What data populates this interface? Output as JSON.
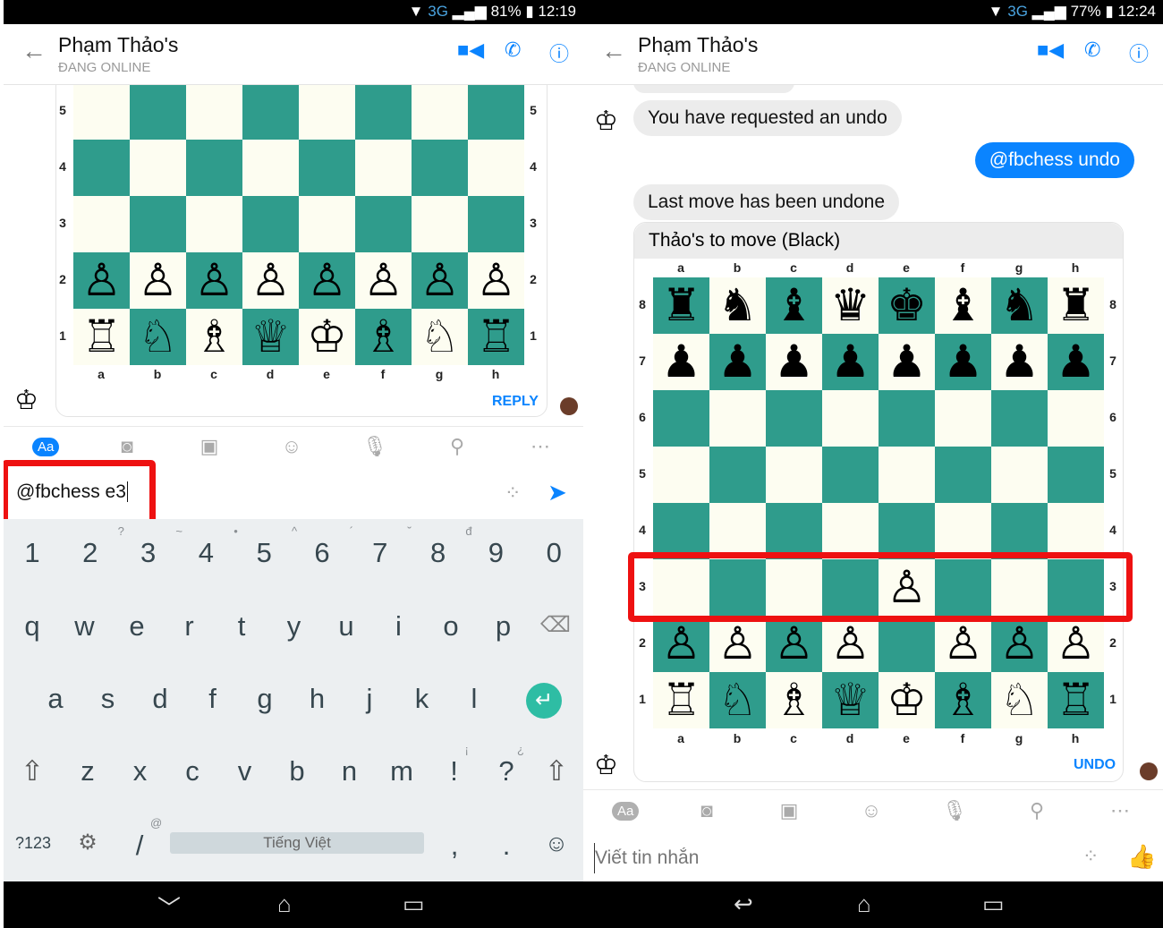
{
  "colors": {
    "accent": "#0a84ff",
    "board_dark": "#2f9c8c",
    "board_light": "#fdfdf1",
    "highlight": "#ee1111"
  },
  "left": {
    "status": {
      "network": "3G",
      "battery": "81%",
      "time": "12:19"
    },
    "header": {
      "title": "Phạm Thảo's",
      "subtitle": "ĐANG ONLINE"
    },
    "board": {
      "files": [
        "a",
        "b",
        "c",
        "d",
        "e",
        "f",
        "g",
        "h"
      ],
      "ranks": [
        "5",
        "4",
        "3",
        "2",
        "1"
      ],
      "rows": [
        "........",
        "........",
        "........",
        "PPPPPPPP",
        "RNBQKBNR"
      ]
    },
    "reply_label": "REPLY",
    "composer": {
      "mode_label": "Aa",
      "value": "@fbchess e3"
    },
    "keyboard": {
      "numbers": [
        "1",
        "2",
        "3",
        "4",
        "5",
        "6",
        "7",
        "8",
        "9",
        "0"
      ],
      "number_hints": [
        "",
        "",
        "?",
        "~",
        "•",
        "^",
        "´",
        "˘",
        "đ",
        ""
      ],
      "row1": [
        "q",
        "w",
        "e",
        "r",
        "t",
        "y",
        "u",
        "i",
        "o",
        "p"
      ],
      "row2": [
        "a",
        "s",
        "d",
        "f",
        "g",
        "h",
        "j",
        "k",
        "l"
      ],
      "row3": [
        "z",
        "x",
        "c",
        "v",
        "b",
        "n",
        "m",
        "!",
        "?"
      ],
      "row3_hints": [
        "",
        "",
        "",
        "",
        "",
        "",
        "",
        "¡",
        "¿"
      ],
      "symbols_key": "?123",
      "slash_key": "/",
      "slash_hint": "@",
      "space_label": "Tiếng Việt",
      "comma_key": ",",
      "period_key": "."
    }
  },
  "right": {
    "status": {
      "network": "3G",
      "battery": "77%",
      "time": "12:24"
    },
    "header": {
      "title": "Phạm Thảo's",
      "subtitle": "ĐANG ONLINE"
    },
    "messages": [
      {
        "from": "bot",
        "text": "You have requested an undo"
      },
      {
        "from": "me",
        "text": "@fbchess undo"
      },
      {
        "from": "bot",
        "text": "Last move has been undone"
      }
    ],
    "board_caption": "Thảo's to move (Black)",
    "board": {
      "files": [
        "a",
        "b",
        "c",
        "d",
        "e",
        "f",
        "g",
        "h"
      ],
      "ranks": [
        "8",
        "7",
        "6",
        "5",
        "4",
        "3",
        "2",
        "1"
      ],
      "rows": [
        "rnbqkbnr",
        "pppppppp",
        "........",
        "........",
        "........",
        "....P...",
        "PPPP.PPP",
        "RNBQKBNR"
      ]
    },
    "undo_label": "UNDO",
    "composer": {
      "mode_label": "Aa",
      "placeholder": "Viết tin nhắn"
    }
  }
}
